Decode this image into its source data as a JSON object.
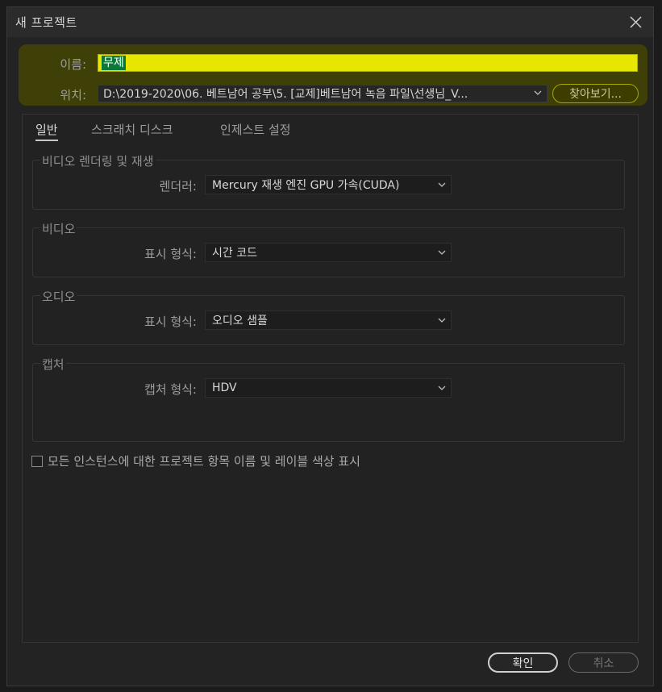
{
  "dialog": {
    "title": "새 프로젝트",
    "close_icon": "close-icon"
  },
  "name_row": {
    "label": "이름:",
    "value": "무제"
  },
  "location_row": {
    "label": "위치:",
    "value": "D:\\2019-2020\\06. 베트남어 공부\\5. [교제]베트남어 녹음 파일\\선생님_V...",
    "browse_label": "찾아보기..."
  },
  "tabs": [
    {
      "label": "일반",
      "active": true
    },
    {
      "label": "스크래치 디스크",
      "active": false
    },
    {
      "label": "인제스트 설정",
      "active": false
    }
  ],
  "groups": {
    "video_render": {
      "title": "비디오 렌더링 및 재생",
      "field_label": "렌더러:",
      "value": "Mercury 재생 엔진 GPU 가속(CUDA)"
    },
    "video": {
      "title": "비디오",
      "field_label": "표시 형식:",
      "value": "시간 코드"
    },
    "audio": {
      "title": "오디오",
      "field_label": "표시 형식:",
      "value": "오디오 샘플"
    },
    "capture": {
      "title": "캡처",
      "field_label": "캡처 형식:",
      "value": "HDV"
    }
  },
  "checkbox": {
    "label": "모든 인스턴스에 대한 프로젝트 항목 이름 및 레이블 색상 표시",
    "checked": false
  },
  "buttons": {
    "ok": "확인",
    "cancel": "취소"
  },
  "colors": {
    "highlight": "#e6e600",
    "selection": "#0a7a3a",
    "background": "#232323"
  }
}
